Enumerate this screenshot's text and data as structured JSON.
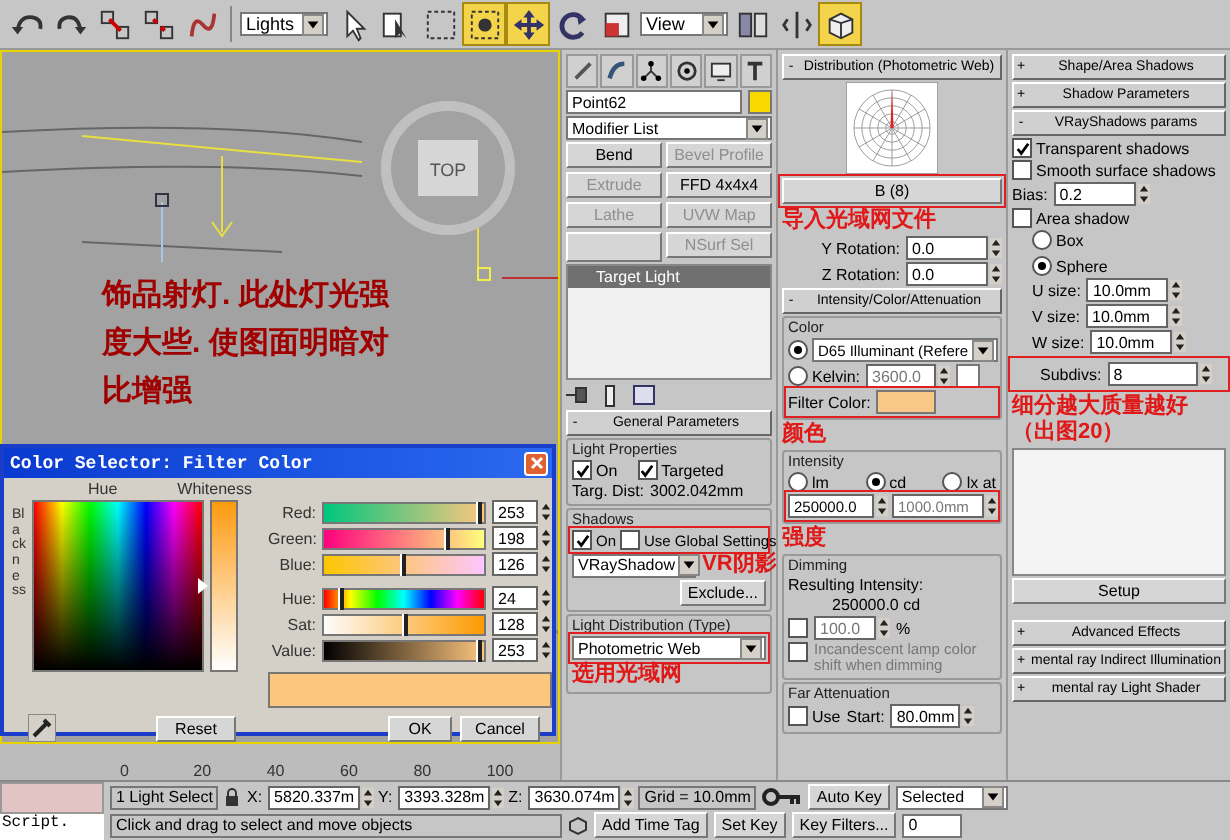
{
  "toolbar": {
    "tools": [
      {
        "kind": "undo",
        "selected": false
      },
      {
        "kind": "redo",
        "selected": false
      },
      {
        "kind": "link",
        "selected": false
      },
      {
        "kind": "unlink",
        "selected": false
      },
      {
        "kind": "bind",
        "selected": false
      }
    ],
    "selection_filter": "Lights",
    "tools_2": [
      {
        "kind": "select",
        "selected": false
      },
      {
        "kind": "select-by-name",
        "selected": false
      },
      {
        "kind": "region",
        "selected": false
      },
      {
        "kind": "window",
        "selected": true
      },
      {
        "kind": "move",
        "selected": true
      },
      {
        "kind": "rotate",
        "selected": false
      },
      {
        "kind": "scale",
        "selected": false
      }
    ],
    "coordinate_system": "View",
    "tools_3": [
      {
        "kind": "pivot",
        "selected": false
      },
      {
        "kind": "mirror",
        "selected": false
      },
      {
        "kind": "snap",
        "selected": true
      }
    ]
  },
  "viewport": {
    "viewcube_label": "TOP"
  },
  "annotations": [
    {
      "text": "饰品射灯. 此处灯光强度大些. 使图面明暗对比增强"
    },
    {
      "text": "导入光域网文件"
    },
    {
      "text": "颜色"
    },
    {
      "text": "强度"
    },
    {
      "text": "VR阴影"
    },
    {
      "text": "选用光域网"
    },
    {
      "text": "细分越大质量越好（出图20）"
    }
  ],
  "color_selector": {
    "title": "Color Selector: Filter Color",
    "hue_label": "Hue",
    "whiteness_label": "Whiteness",
    "blackness_label": "Blackness",
    "whiteness": {
      "level": 0.5
    },
    "channels": [
      {
        "kind": "red",
        "label": "Red:",
        "value": "253",
        "level": 0.99
      },
      {
        "kind": "green",
        "label": "Green:",
        "value": "198",
        "level": 0.78
      },
      {
        "kind": "blue",
        "label": "Blue:",
        "value": "126",
        "level": 0.49
      },
      {
        "kind": "hue",
        "label": "Hue:",
        "value": "24",
        "level": 0.09
      },
      {
        "kind": "sat",
        "label": "Sat:",
        "value": "128",
        "level": 0.5
      },
      {
        "kind": "value",
        "label": "Value:",
        "value": "253",
        "level": 0.99
      }
    ],
    "reset": "Reset",
    "ok": "OK",
    "cancel": "Cancel"
  },
  "command_panel": {
    "object_name": "Point62",
    "modifier_list": "Modifier List",
    "modifier_buttons": [
      {
        "kind": "button",
        "label": "Bend",
        "disabled": false
      },
      {
        "kind": "button",
        "label": "Bevel Profile",
        "disabled": true
      },
      {
        "kind": "button",
        "label": "Extrude",
        "disabled": true
      },
      {
        "kind": "button",
        "label": "FFD 4x4x4",
        "disabled": false
      },
      {
        "kind": "button",
        "label": "Lathe",
        "disabled": true
      },
      {
        "kind": "button",
        "label": "UVW Map",
        "disabled": true
      },
      {
        "kind": "blank"
      },
      {
        "kind": "button",
        "label": "NSurf Sel",
        "disabled": true
      }
    ],
    "stack": [
      {
        "label": "Target Light",
        "selected": true
      }
    ]
  },
  "general_parameters": {
    "sign": "-",
    "title": "General Parameters",
    "light_properties": "Light Properties",
    "on": {
      "label": "On",
      "checked": true
    },
    "targeted": {
      "label": "Targeted",
      "checked": true
    },
    "targ_dist_label": "Targ. Dist:",
    "targ_dist": "3002.042mm",
    "shadows": "Shadows",
    "shadows_on": {
      "label": "On",
      "checked": true
    },
    "use_global": {
      "label": "Use Global Settings",
      "checked": false
    },
    "shadow_type": "VRayShadow",
    "exclude": "Exclude...",
    "light_distribution": "Light Distribution (Type)",
    "distribution_type": "Photometric Web"
  },
  "distribution": {
    "sign": "-",
    "title": "Distribution (Photometric Web)",
    "file": "B (8)",
    "y_rotation_label": "Y Rotation:",
    "y_rotation": "0.0",
    "z_rotation_label": "Z Rotation:",
    "z_rotation": "0.0"
  },
  "intensity": {
    "sign": "-",
    "title": "Intensity/Color/Attenuation",
    "color_group": "Color",
    "d65": {
      "label": "D65 Illuminant (Refere",
      "selected": true
    },
    "kelvin": {
      "label": "Kelvin:",
      "selected": false
    },
    "kelvin_value": {
      "value": "3600.0",
      "disabled": true
    },
    "filter_color_label": "Filter Color:",
    "intensity_group": "Intensity",
    "units": [
      {
        "label": "lm",
        "selected": false
      },
      {
        "label": "cd",
        "selected": true
      },
      {
        "label": "lx at",
        "selected": false
      }
    ],
    "intensity_value": {
      "value": "250000.0",
      "disabled": false
    },
    "distance_value": {
      "value": "1000.0mm",
      "disabled": true
    },
    "dimming_group": "Dimming",
    "resulting_label": "Resulting Intensity:",
    "resulting_value": "250000.0 cd",
    "dimming_percent": {
      "checked": false,
      "value": "100.0",
      "disabled": true,
      "unit": "%"
    },
    "incandescent": {
      "label": "Incandescent lamp color shift when dimming",
      "checked": false,
      "disabled": true
    },
    "far_group": "Far Attenuation",
    "far_use": {
      "label": "Use",
      "checked": false
    },
    "far_start_label": "Start:",
    "far_start": "80.0mm"
  },
  "shadows_panel": {
    "rollouts_top": [
      {
        "sign": "+",
        "title": "Shape/Area Shadows"
      },
      {
        "sign": "+",
        "title": "Shadow Parameters"
      },
      {
        "sign": "-",
        "title": "VRayShadows params"
      }
    ],
    "transparent": {
      "label": "Transparent shadows",
      "checked": true
    },
    "smooth": {
      "label": "Smooth surface shadows",
      "checked": false
    },
    "bias_label": "Bias:",
    "bias": "0.2",
    "area_shadow": {
      "label": "Area shadow",
      "checked": false
    },
    "shape": [
      {
        "label": "Box",
        "selected": false
      },
      {
        "label": "Sphere",
        "selected": true
      }
    ],
    "sizes": [
      {
        "label": "U size:",
        "value": "10.0mm"
      },
      {
        "label": "V size:",
        "value": "10.0mm"
      },
      {
        "label": "W size:",
        "value": "10.0mm"
      }
    ],
    "subdivs_label": "Subdivs:",
    "subdivs": "8",
    "setup": "Setup",
    "rollouts_bottom": [
      {
        "sign": "+",
        "title": "Advanced Effects"
      },
      {
        "sign": "+",
        "title": "mental ray Indirect Illumination"
      },
      {
        "sign": "+",
        "title": "mental ray Light Shader"
      }
    ]
  },
  "time_slider": {
    "ticks": [
      "0",
      "20",
      "40",
      "60",
      "80",
      "100"
    ]
  },
  "status_bar": {
    "script": "Script.",
    "selection": "1 Light Select",
    "x_label": "X:",
    "x": "5820.337m",
    "y_label": "Y:",
    "y": "3393.328m",
    "z_label": "Z:",
    "z": "3630.074m",
    "grid": "Grid = 10.0mm",
    "auto_key": "Auto Key",
    "key_mode": "Selected",
    "prompt": "Click and drag to select and move objects",
    "add_time_tag": "Add Time Tag",
    "set_key": "Set Key",
    "key_filters": "Key Filters...",
    "frame": "0"
  }
}
